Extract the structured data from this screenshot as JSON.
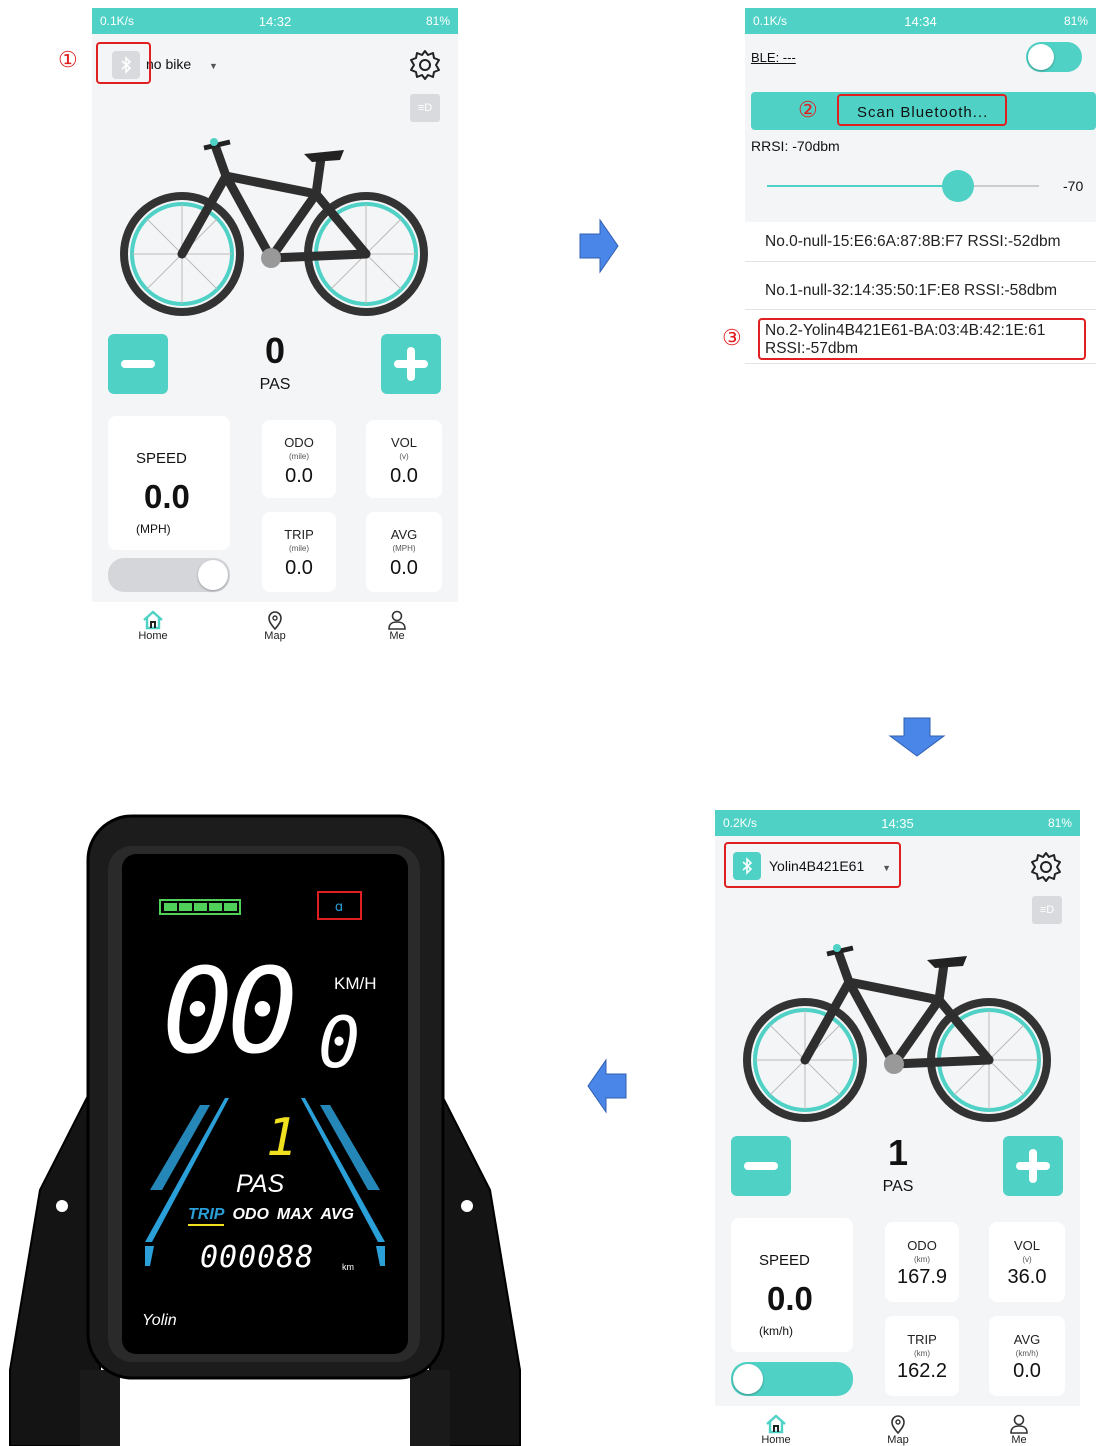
{
  "screen1": {
    "status": {
      "speed": "0.1K/s",
      "time": "14:32",
      "battery": "81%"
    },
    "bike_selector": "no bike",
    "step_marker": "①",
    "pas_value": "0",
    "pas_label": "PAS",
    "speed_label": "SPEED",
    "speed_value": "0.0",
    "speed_unit": "(MPH)",
    "odo": {
      "label": "ODO",
      "unit": "(mile)",
      "value": "0.0"
    },
    "vol": {
      "label": "VOL",
      "unit": "(v)",
      "value": "0.0"
    },
    "trip": {
      "label": "TRIP",
      "unit": "(mile)",
      "value": "0.0"
    },
    "avg": {
      "label": "AVG",
      "unit": "(MPH)",
      "value": "0.0"
    },
    "nav": [
      "Home",
      "Map",
      "Me"
    ]
  },
  "screen2": {
    "status": {
      "speed": "0.1K/s",
      "time": "14:34",
      "battery": "81%"
    },
    "ble_label": "BLE: ---",
    "scan_button": "Scan Bluetooth...",
    "scan_marker": "②",
    "rssi_label": "RRSI:  -70dbm",
    "rssi_value": "-70",
    "rssi_fraction": 0.71,
    "devices": [
      "No.0-null-15:E6:6A:87:8B:F7 RSSI:-52dbm",
      "No.1-null-32:14:35:50:1F:E8 RSSI:-58dbm",
      "No.2-Yolin4B421E61-BA:03:4B:42:1E:61",
      "RSSI:-57dbm"
    ],
    "device_marker": "③"
  },
  "screen3": {
    "status": {
      "speed": "0.2K/s",
      "time": "14:35",
      "battery": "81%"
    },
    "bike_selector": "Yolin4B421E61",
    "pas_value": "1",
    "pas_label": "PAS",
    "speed_label": "SPEED",
    "speed_value": "0.0",
    "speed_unit": "(km/h)",
    "odo": {
      "label": "ODO",
      "unit": "(km)",
      "value": "167.9"
    },
    "vol": {
      "label": "VOL",
      "unit": "(v)",
      "value": "36.0"
    },
    "trip": {
      "label": "TRIP",
      "unit": "(km)",
      "value": "162.2"
    },
    "avg": {
      "label": "AVG",
      "unit": "(km/h)",
      "value": "0.0"
    },
    "nav": [
      "Home",
      "Map",
      "Me"
    ]
  },
  "display": {
    "speed_unit": "KM/H",
    "speed_digits": "00",
    "speed_decimal": "0",
    "pas_level": "1",
    "pas_label": "PAS",
    "modes": [
      "TRIP",
      "ODO",
      "MAX",
      "AVG"
    ],
    "odometer": "000088",
    "odometer_unit": "km",
    "brand": "Yolin"
  },
  "colors": {
    "accent": "#4fd1c5",
    "marker": "#e02020",
    "arrow": "#4a86e8",
    "lcd_blue": "#2a9fd8",
    "lcd_yellow": "#f0e020"
  }
}
